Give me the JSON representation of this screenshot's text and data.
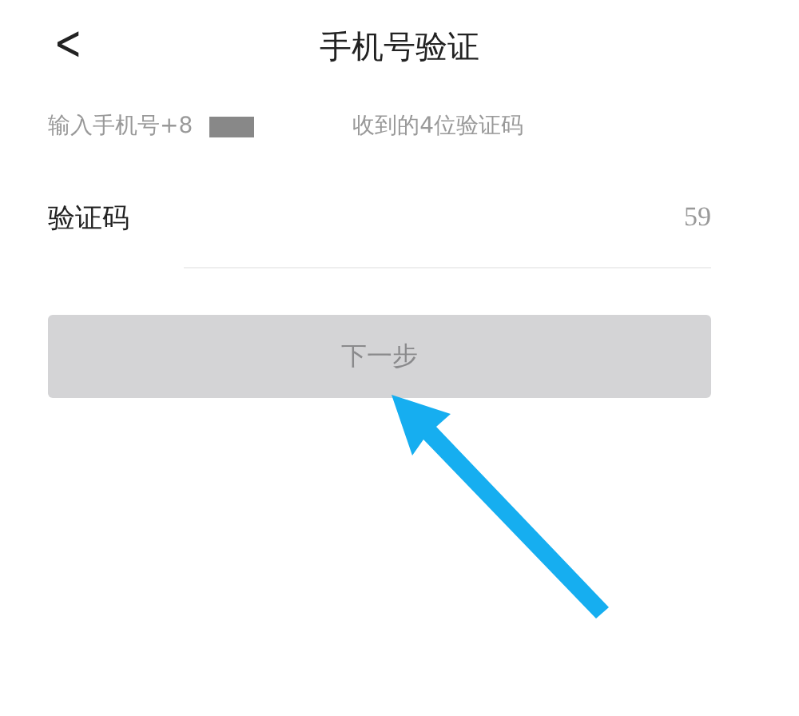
{
  "header": {
    "back": "<",
    "title": "手机号验证"
  },
  "instruction": {
    "before_redaction": "输入手机号+8",
    "after_redaction": "收到的4位验证码"
  },
  "code_field": {
    "label": "验证码",
    "countdown": "59"
  },
  "next_button": {
    "label": "下一步",
    "disabled": true
  }
}
